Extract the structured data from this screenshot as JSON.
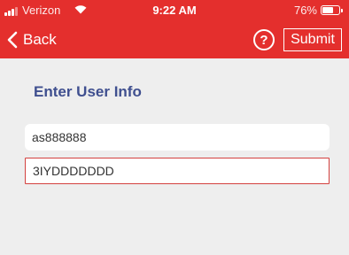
{
  "status_bar": {
    "carrier": "Verizon",
    "time": "9:22 AM",
    "battery_percent": "76%",
    "battery_level": 0.76,
    "icons": [
      "signal-icon",
      "wifi-icon",
      "battery-icon"
    ]
  },
  "nav": {
    "back_label": "Back",
    "back_icon": "chevron-left-icon",
    "help_label": "?",
    "help_icon": "help-circle-icon",
    "submit_label": "Submit"
  },
  "form": {
    "title": "Enter User Info",
    "fields": [
      {
        "value": "as888888"
      },
      {
        "value": "3IYDDDDDDD"
      }
    ]
  },
  "colors": {
    "header_bg": "#e42f2d",
    "title_text": "#3f4f8f",
    "active_field_border": "#d3413f",
    "page_bg": "#eeeeee"
  }
}
